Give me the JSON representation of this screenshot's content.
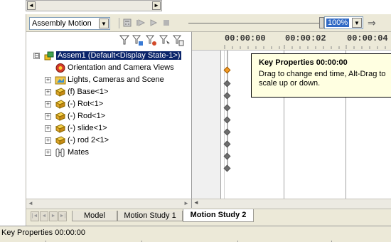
{
  "window": {
    "colors": {
      "face": "#ece9d8",
      "selection": "#0a246a",
      "tooltip_bg": "#ffffe1",
      "key_orange": "#f39a24"
    }
  },
  "top_scroll": {
    "left_arrow": "◄",
    "right_arrow": "►"
  },
  "toolbar": {
    "study_type": "Assembly Motion",
    "dropdown_arrow": "▼",
    "zoom": "100%",
    "next_arrow": "⇒",
    "icons": [
      "calculator-icon",
      "play-from-start-icon",
      "play-icon",
      "stop-icon"
    ]
  },
  "tree": {
    "filter_icons": [
      "filter-icon",
      "filter-animation-icon",
      "filter-driving-icon",
      "filter-selected-icon",
      "filter-results-icon"
    ],
    "items": [
      {
        "label": "Assem1  (Default<Display State-1>)",
        "icon": "assembly-icon",
        "expander": "⊟",
        "selected": true
      },
      {
        "label": "Orientation and Camera Views",
        "icon": "camera-views-icon",
        "expander": ""
      },
      {
        "label": "Lights, Cameras and Scene",
        "icon": "lights-folder-icon",
        "expander": "+"
      },
      {
        "label": "(f) Base<1>",
        "icon": "part-icon",
        "expander": "+"
      },
      {
        "label": "(-) Rot<1>",
        "icon": "part-icon",
        "expander": "+"
      },
      {
        "label": "(-) Rod<1>",
        "icon": "part-icon",
        "expander": "+"
      },
      {
        "label": "(-) slide<1>",
        "icon": "part-icon",
        "expander": "+"
      },
      {
        "label": "(-) rod 2<1>",
        "icon": "part-icon",
        "expander": "+"
      },
      {
        "label": "Mates",
        "icon": "mates-icon",
        "expander": "+"
      }
    ]
  },
  "timeline": {
    "time_labels": [
      "00:00:00",
      "00:00:02",
      "00:00:04"
    ],
    "tooltip": {
      "title": "Key Properties 00:00:00",
      "body": "Drag to change end time, Alt-Drag to scale up or down."
    }
  },
  "tabs": [
    {
      "label": "Model",
      "active": false
    },
    {
      "label": "Motion Study 1",
      "active": false
    },
    {
      "label": "Motion Study 2",
      "active": true
    }
  ],
  "tab_nav": [
    "|◄",
    "◄",
    "►",
    "►|"
  ],
  "status": {
    "text": "Key Properties 00:00:00"
  }
}
